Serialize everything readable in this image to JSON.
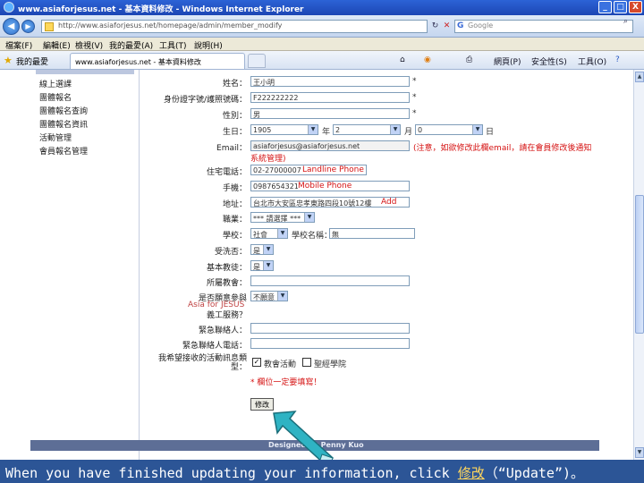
{
  "window": {
    "title": "www.asiaforjesus.net - 基本資料修改 - Windows Internet Explorer",
    "minimize": "_",
    "maximize": "□",
    "close": "X"
  },
  "addressbar": {
    "url": "http://www.asiaforjesus.net/homepage/admin/member_modify",
    "search_placeholder": "Google"
  },
  "menubar": {
    "items": [
      "檔案(F)",
      "編輯(E)",
      "檢視(V)",
      "我的最愛(A)",
      "工具(T)",
      "說明(H)"
    ]
  },
  "favbar": {
    "favorites_label": "我的最愛",
    "tab_title": "www.asiaforjesus.net - 基本資料修改",
    "commands": [
      "首頁",
      "RSS",
      "列印",
      "網頁(P)",
      "安全性(S)",
      "工具(O)",
      "說明"
    ]
  },
  "sidebar": {
    "links": [
      "線上選課",
      "團體報名",
      "團體報名查詢",
      "團體報名資訊",
      "活動管理",
      "會員報名管理"
    ]
  },
  "form": {
    "name_label": "姓名：",
    "name_value": "王小明",
    "id_label": "身份證字號/護照號碼：",
    "id_value": "F222222222",
    "gender_label": "性別：",
    "gender_value": "男",
    "birthday_label": "生日：",
    "birth_year": "1905",
    "year_unit": "年",
    "birth_month": "2",
    "month_unit": "月",
    "birth_day": "0",
    "day_unit": "日",
    "email_label": "Email：",
    "email_value": "asiaforjesus@asiaforjesus.net",
    "email_note_line1": "(注意，如欲修改此欄email，請在會員修改後通知",
    "email_note_line2": "系統管理)",
    "phone_label": "住宅電話：",
    "phone_value": "02-27000007",
    "phone_hint": "Landline Phone",
    "mobile_label": "手機：",
    "mobile_value": "0987654321",
    "mobile_hint": "Mobile Phone",
    "address_label": "地址：",
    "address_value": "台北市大安區忠孝東路四段10號12樓",
    "address_hint": "Add",
    "occupation_label": "職業：",
    "occupation_value": "*** 請選擇 ***",
    "school_label": "學校：",
    "school_type": "社會",
    "school_name_label": "學校名稱：",
    "school_name_value": "無",
    "baptized_label": "受洗否：",
    "baptized_value": "是",
    "christian_label": "基本教徒：",
    "christian_value": "是",
    "church_label": "所屬教會：",
    "asia_label": "是否願意參與",
    "asia_hint": "Asia for JESUS",
    "asia_label2": "義工服務？",
    "asia_value": "不願意",
    "contact_label": "緊急聯絡人：",
    "contact_phone_label": "緊急聯絡人電話：",
    "info_label": "我希望接收的活動訊息類型：",
    "info_opt1": "教會活動",
    "info_opt2": "聖經學院",
    "required_note": "* 欄位一定要填寫！",
    "submit_label": "修改",
    "required_mark": "*"
  },
  "footer": {
    "designer": "Designed by Penny Kuo"
  },
  "caption": {
    "before": "When you have finished updating your information, click ",
    "highlight": "修改",
    "after": "（“Update”)。"
  },
  "colors": {
    "caption_bg": "#2c5596",
    "highlight": "#ffd65c",
    "arrow": "#2fb3c3",
    "red_text": "#d51212"
  }
}
